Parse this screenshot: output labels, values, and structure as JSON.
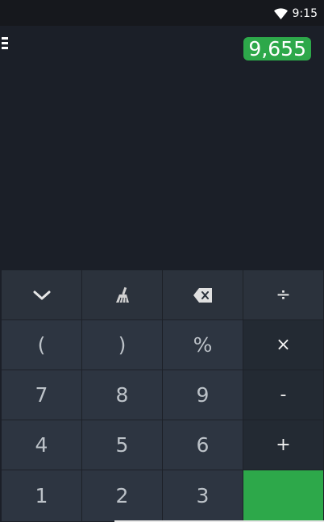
{
  "status_bar": {
    "time": "9:15",
    "wifi_icon": "wifi-icon"
  },
  "display": {
    "menu_icon": "hamburger-menu-icon",
    "result": "9,655",
    "result_color": "#2da84a"
  },
  "keypad": {
    "row1": {
      "collapse_icon": "chevron-down-icon",
      "clear_icon": "broom-icon",
      "backspace_icon": "backspace-icon",
      "divide": "÷"
    },
    "row2": {
      "open_paren": "(",
      "close_paren": ")",
      "percent": "%",
      "multiply": "×"
    },
    "row3": {
      "seven": "7",
      "eight": "8",
      "nine": "9",
      "minus": "-"
    },
    "row4": {
      "four": "4",
      "five": "5",
      "six": "6",
      "plus": "+"
    },
    "row5": {
      "one": "1",
      "two": "2",
      "three": "3"
    },
    "equals_color": "#2da84a"
  }
}
